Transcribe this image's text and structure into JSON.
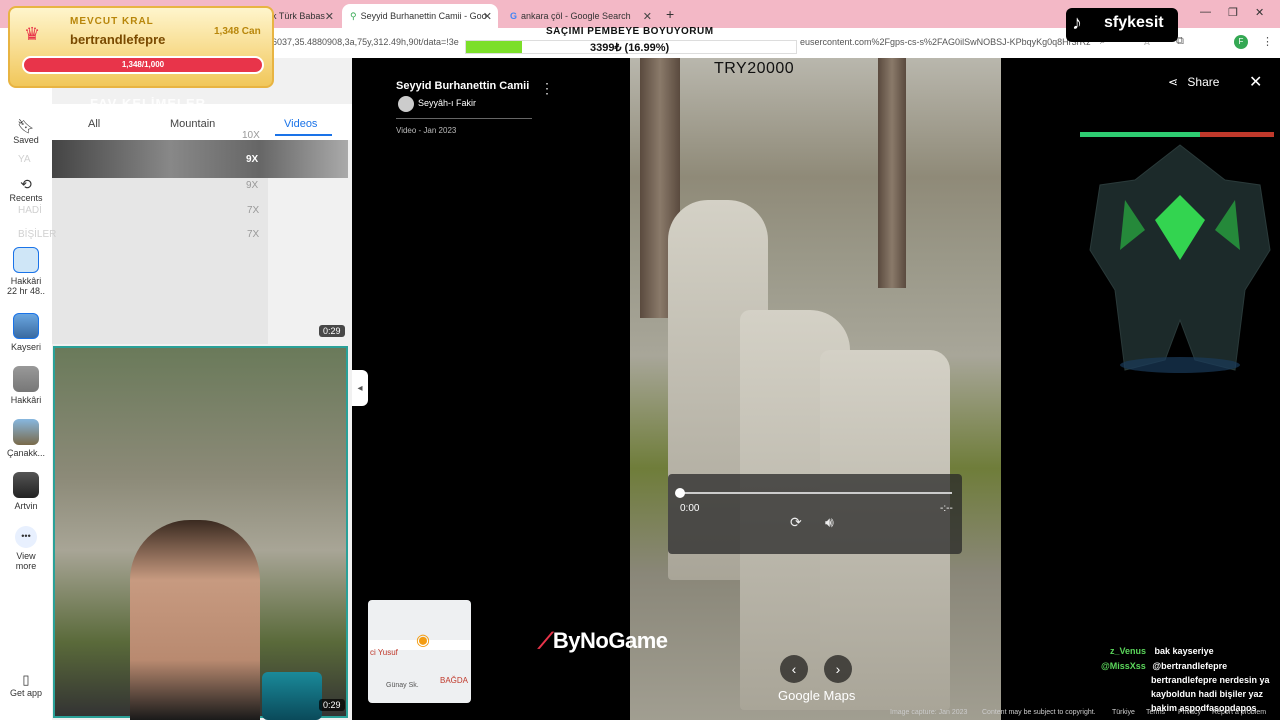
{
  "browser": {
    "tabs": [
      {
        "title": "k Türk Babas"
      },
      {
        "title": "Seyyid Burhanettin Camii - Goo"
      },
      {
        "title": "ankara çöl - Google Search"
      }
    ],
    "url_left": "6037,35.4880908,3a,75y,312.49h,90t/data=!3e",
    "url_right": "eusercontent.com%2Fgps-cs-s%2FAG0ilSwNOBSJ-KPbqyKg0q8Hr3rRz"
  },
  "sidebar": {
    "items": [
      {
        "label": "Saved",
        "icon": "bookmark-icon"
      },
      {
        "label": "Recents",
        "icon": "history-icon"
      },
      {
        "label": "Hakkâri",
        "sub": "22 hr 48.."
      },
      {
        "label": "Kayseri"
      },
      {
        "label": "Hakkâri"
      },
      {
        "label": "Çanakk..."
      },
      {
        "label": "Artvin"
      },
      {
        "label": "View more"
      },
      {
        "label": "Get app"
      }
    ]
  },
  "filters": {
    "chips": [
      "All",
      "Mountain",
      "Videos"
    ],
    "active": "Videos"
  },
  "videos": [
    {
      "duration": "0:29"
    },
    {
      "duration": "0:29"
    }
  ],
  "viewer": {
    "title": "Seyyid Burhanettin Camii",
    "author": "Seyyâh-ı Fakir",
    "date": "Video - Jan 2023",
    "share_label": "Share",
    "close_glyph": "✕",
    "player": {
      "current": "0:00",
      "end": "-:--",
      "progress": 0
    },
    "google_maps": "Google Maps",
    "footer": [
      "Image capture: Jan 2023",
      "Content may be subject to copyright.",
      "Türkiye",
      "Terms",
      "Privacy",
      "Report a problem"
    ],
    "minimap": {
      "place": "ci Yusuf",
      "street": "Günay Sk.",
      "district": "BAĞDA"
    }
  },
  "overlays": {
    "king": {
      "title": "MEVCUT KRAL",
      "name": "bertrandlefepre",
      "coins": "1,348 Can",
      "bar": "1,348/1,000"
    },
    "fav": {
      "title": "FAV KELİMELER",
      "words": [
        "YA",
        "HADİ",
        "BİŞİLER"
      ],
      "multipliers": [
        "10X",
        "9X",
        "9X",
        "7X",
        "7X"
      ]
    },
    "banner": "SAÇIMI PEMBEYE BOYUYORUM",
    "goal": {
      "text": "3399₺ (16.99%)",
      "fraction": 0.1699
    },
    "try_text": "TRY20000",
    "tiktok": "sfykesit",
    "golem_hp_fraction": 0.62,
    "bynogame": "ByNoGame",
    "chat": [
      {
        "user": "z_Venus",
        "message": "bak kayseriye"
      },
      {
        "user": "@MissXss",
        "message": "@bertrandlefepre"
      },
      {
        "user": "",
        "message": "bertrandlefepre nerdesin ya"
      },
      {
        "user": "",
        "message": "kayboldun hadi bişiler yaz"
      },
      {
        "user": "",
        "message": "bakim aspodfasopdapos"
      }
    ]
  },
  "colors": {
    "accent": "#1a73e8",
    "tab_bar": "#f3b8c6",
    "selected_border": "#2aa198"
  }
}
